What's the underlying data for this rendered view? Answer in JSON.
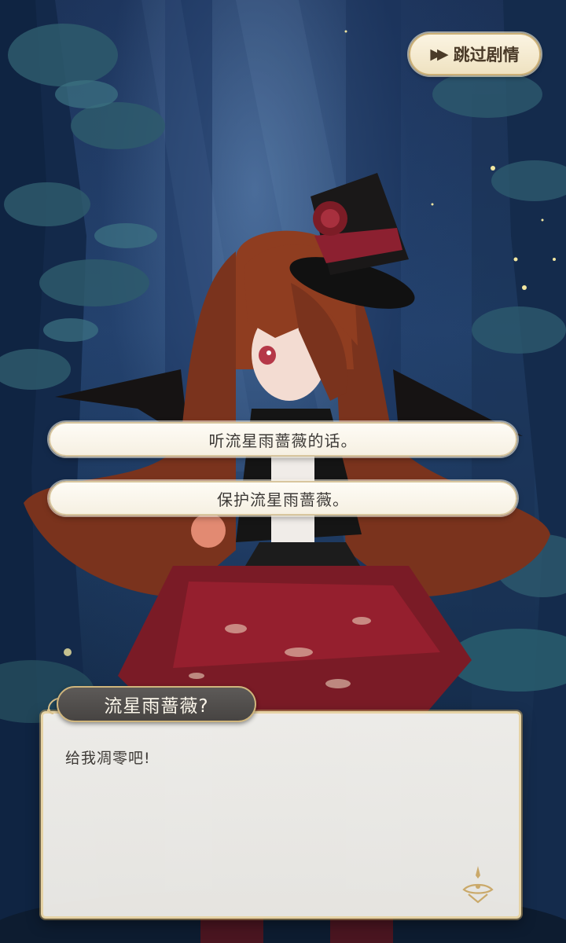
{
  "skip": {
    "label": "跳过剧情",
    "icon": "fast-forward-icon"
  },
  "choices": [
    {
      "label": "听流星雨蔷薇的话。"
    },
    {
      "label": "保护流星雨蔷薇。"
    }
  ],
  "dialogue": {
    "speaker": "流星雨蔷薇?",
    "text": "给我凋零吧!"
  },
  "colors": {
    "button_bg": "#f6f0e2",
    "button_border": "#d8c69e",
    "name_tag_bg": "#4f4c4a",
    "gold_accent": "#cfb57c",
    "text_dark": "#3e3a36"
  }
}
